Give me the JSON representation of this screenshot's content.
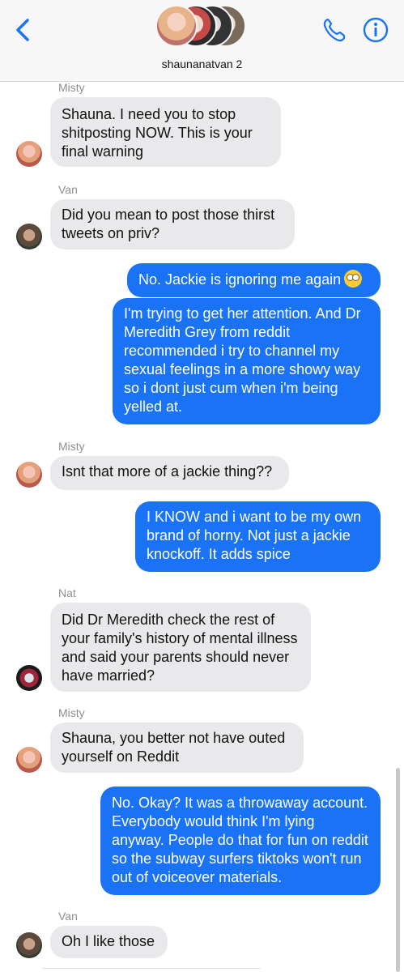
{
  "header": {
    "group_name": "shaunanatvan 2",
    "back_icon": "chevron-left-icon",
    "call_icon": "phone-icon",
    "info_icon": "info-icon",
    "accent_color": "#1a73f5"
  },
  "messages": [
    {
      "type": "received",
      "sender": "Misty",
      "text": "Shauna. I need you to stop shitposting NOW. This is your final warning"
    },
    {
      "type": "received",
      "sender": "Van",
      "text": "Did you mean to post those thirst tweets on priv?"
    },
    {
      "type": "sent",
      "text": "No. Jackie is ignoring me again",
      "emoji": "eye-roll-emoji"
    },
    {
      "type": "sent",
      "text": "I'm trying to get her attention. And Dr Meredith Grey from reddit recommended i try to channel my sexual feelings in a more showy way so i dont just cum when i'm being yelled at."
    },
    {
      "type": "received",
      "sender": "Misty",
      "text": "Isnt that more of a jackie thing??"
    },
    {
      "type": "sent",
      "text": "I KNOW and i want to be my own brand of horny. Not just a jackie knockoff. It adds spice"
    },
    {
      "type": "received",
      "sender": "Nat",
      "text": "Did Dr Meredith check the rest of your family's history of mental illness and said your parents should never have married?"
    },
    {
      "type": "received",
      "sender": "Misty",
      "text": "Shauna, you better not have outed yourself on Reddit"
    },
    {
      "type": "sent",
      "text": "No. Okay? It was a throwaway account. Everybody would think I'm lying anyway. People do that for fun on reddit so the subway surfers tiktoks won't run out of voiceover materials."
    },
    {
      "type": "received",
      "sender": "Van",
      "text": "Oh I like those"
    }
  ]
}
